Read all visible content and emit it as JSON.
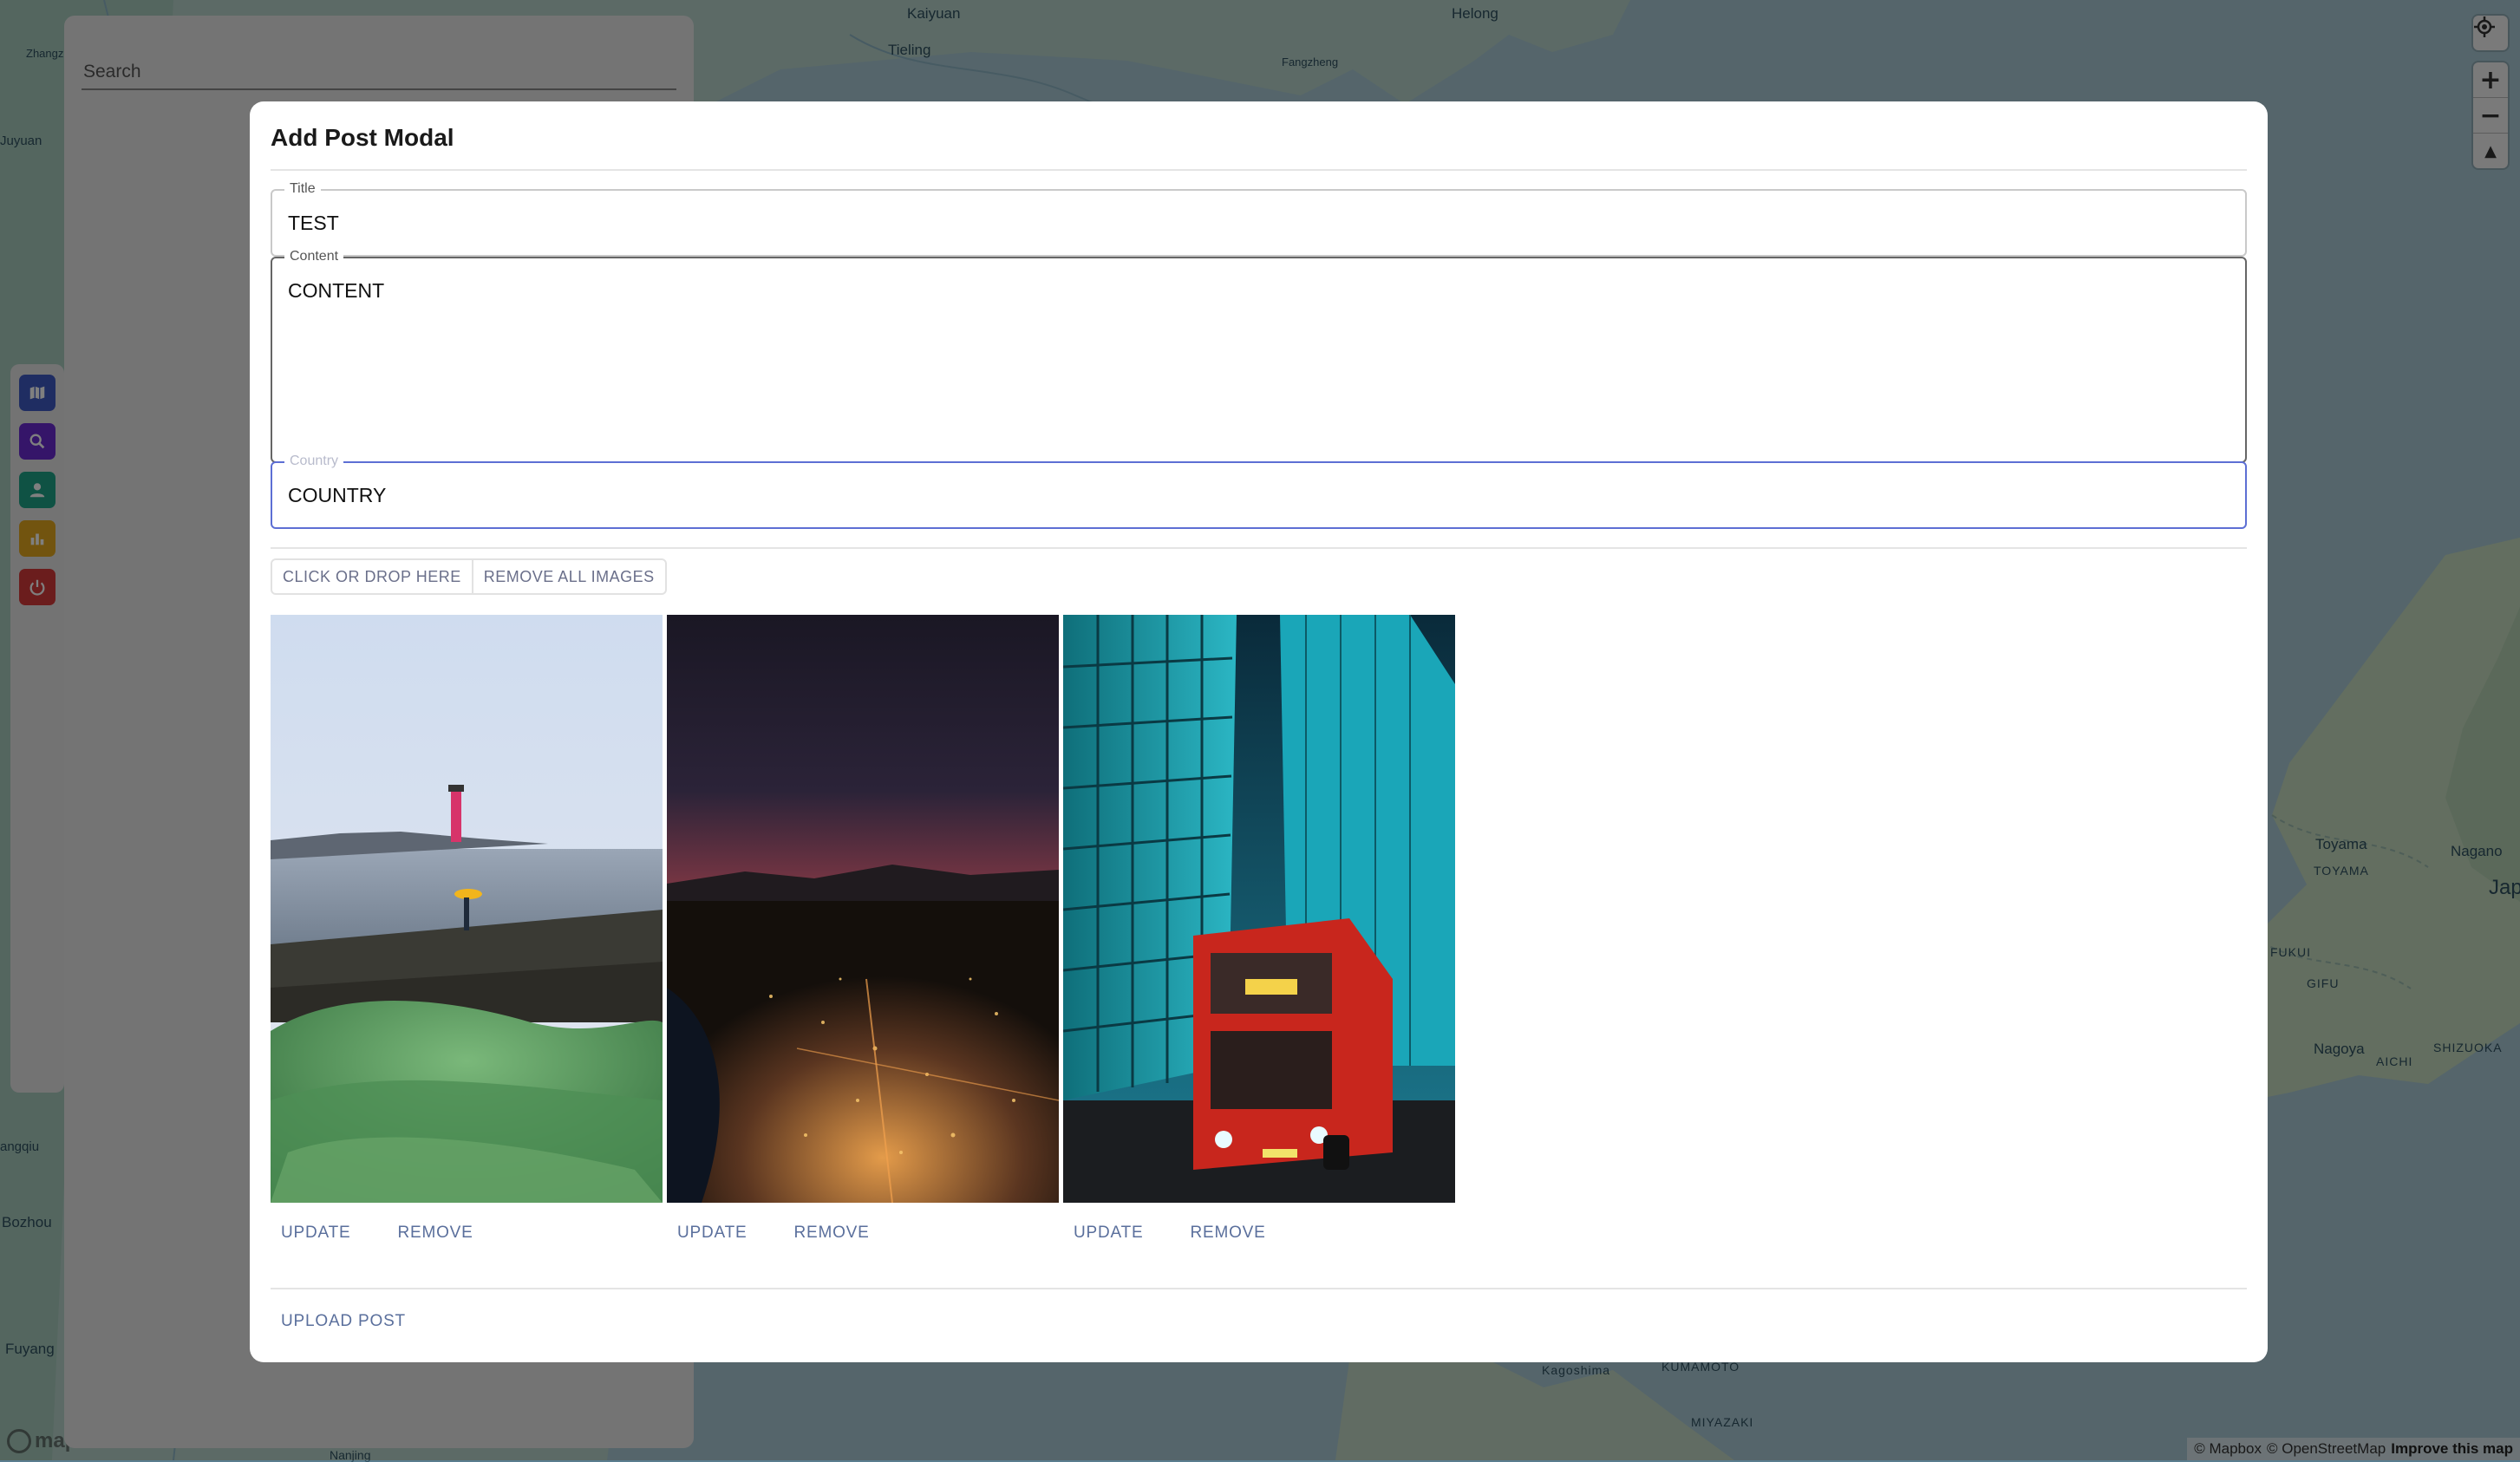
{
  "map": {
    "labels": {
      "kaiyuan": "Kaiyuan",
      "tieling": "Tieling",
      "helong": "Helong",
      "fangzheng": "Fangzheng",
      "zhangzhou": "Zhangzhou",
      "juyuan": "Juyuan",
      "fuyang": "Fuyang",
      "nanjing": "Nanjing",
      "bozhou": "Bozhou",
      "jiangqiu": "angqiu",
      "toyama": "Toyama",
      "toyama_pref": "TOYAMA",
      "nagano": "Nagano",
      "nagoya": "Nagoya",
      "aichi": "AICHI",
      "gifu": "GIFU",
      "fukui": "FUKUI",
      "shizuoka": "SHIZUOKA",
      "japan": "Jap",
      "kagoshima": "Kagoshima",
      "kumamoto": "KUMAMOTO",
      "miyazaki": "MIYAZAKI"
    },
    "attribution": {
      "mapbox": "© Mapbox",
      "osm": "© OpenStreetMap",
      "improve": "Improve this map"
    },
    "logo": "mapbox",
    "controls": {
      "locate_icon": "crosshair-icon",
      "zoom_in": "+",
      "zoom_out": "−",
      "compass": "▲"
    }
  },
  "side_panel": {
    "search_placeholder": "Search",
    "nav_items": [
      {
        "name": "map",
        "icon": "map-icon",
        "color": "#3f5bc4"
      },
      {
        "name": "search",
        "icon": "search-icon",
        "color": "#6a2bd3"
      },
      {
        "name": "profile",
        "icon": "person-icon",
        "color": "#1fa588"
      },
      {
        "name": "stats",
        "icon": "chart-icon",
        "color": "#e5a81e"
      },
      {
        "name": "logout",
        "icon": "power-icon",
        "color": "#d63a3a"
      }
    ]
  },
  "modal": {
    "title": "Add Post Modal",
    "fields": {
      "title": {
        "label": "Title",
        "value": "TEST"
      },
      "content": {
        "label": "Content",
        "value": "CONTENT"
      },
      "country": {
        "label": "Country",
        "value": "COUNTRY"
      }
    },
    "dropzone": {
      "add_label": "CLICK OR DROP HERE",
      "remove_all_label": "REMOVE ALL IMAGES"
    },
    "images": [
      {
        "subject": "lighthouse-coast-photo",
        "update_label": "UPDATE",
        "remove_label": "REMOVE"
      },
      {
        "subject": "city-night-aerial-photo",
        "update_label": "UPDATE",
        "remove_label": "REMOVE"
      },
      {
        "subject": "red-bus-city-photo",
        "update_label": "UPDATE",
        "remove_label": "REMOVE"
      }
    ],
    "upload_label": "UPLOAD POST"
  }
}
